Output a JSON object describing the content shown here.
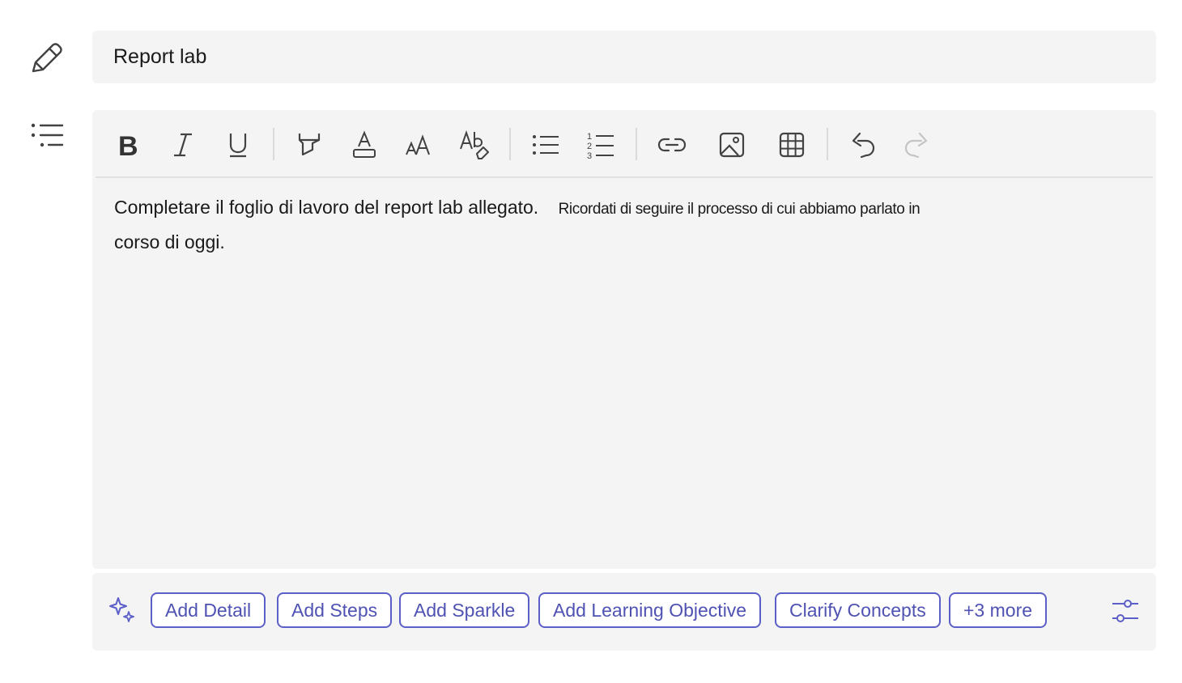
{
  "title_field": {
    "value": "Report lab",
    "icon": "pencil-icon"
  },
  "description": {
    "icon": "list-icon",
    "text_main": "Completare il foglio di lavoro del report lab allegato.",
    "text_small": "Ricordati di seguire il processo di cui abbiamo parlato in",
    "text_line2": "corso di oggi."
  },
  "toolbar": {
    "buttons": [
      "bold-icon",
      "italic-icon",
      "underline-icon",
      "highlight-icon",
      "font-color-icon",
      "font-size-icon",
      "clear-formatting-icon",
      "bulleted-list-icon",
      "numbered-list-icon",
      "link-icon",
      "image-icon",
      "table-icon",
      "undo-icon",
      "redo-icon"
    ],
    "redo_enabled": false
  },
  "suggestions": {
    "sparkle_icon": "sparkle-icon",
    "chips": [
      "Add Detail",
      "Add Steps",
      "Add Sparkle",
      "Add Learning Objective",
      "Clarify Concepts",
      "+3 more"
    ],
    "settings_icon": "sliders-icon"
  },
  "colors": {
    "accent": "#5b5fc7",
    "accent_text": "#4f52b2",
    "field_bg": "#f4f4f4",
    "icon": "#424242",
    "disabled_icon": "#c4c4c4"
  }
}
